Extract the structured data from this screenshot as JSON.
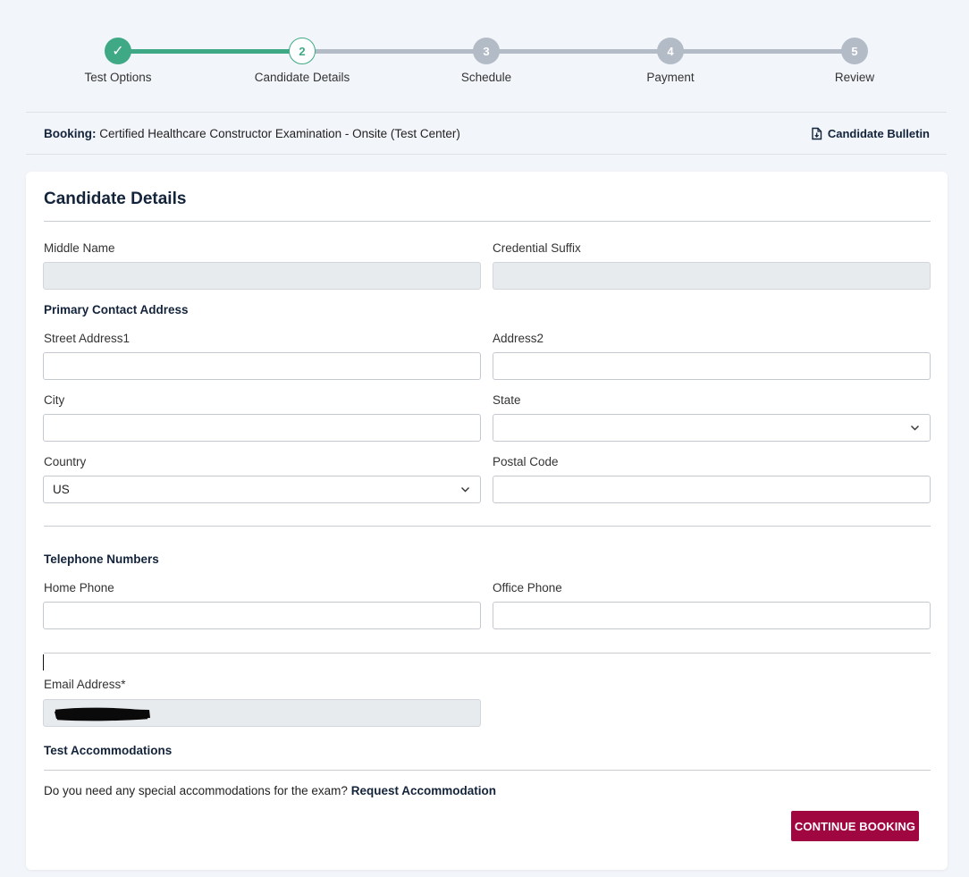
{
  "stepper": {
    "steps": [
      {
        "number": "✓",
        "label": "Test Options",
        "state": "done"
      },
      {
        "number": "2",
        "label": "Candidate Details",
        "state": "active"
      },
      {
        "number": "3",
        "label": "Schedule",
        "state": "todo"
      },
      {
        "number": "4",
        "label": "Payment",
        "state": "todo"
      },
      {
        "number": "5",
        "label": "Review",
        "state": "todo"
      }
    ]
  },
  "booking": {
    "label": "Booking:",
    "value": "Certified Healthcare Constructor Examination - Onsite (Test Center)",
    "bulletin_label": "Candidate Bulletin",
    "bulletin_icon": "document-download-icon"
  },
  "form": {
    "title": "Candidate Details",
    "middle_name": {
      "label": "Middle Name",
      "value": ""
    },
    "credential_suffix": {
      "label": "Credential Suffix",
      "value": ""
    },
    "address_section": "Primary Contact Address",
    "street1": {
      "label": "Street Address1",
      "value": ""
    },
    "address2": {
      "label": "Address2",
      "value": ""
    },
    "city": {
      "label": "City",
      "value": ""
    },
    "state": {
      "label": "State",
      "value": ""
    },
    "country": {
      "label": "Country",
      "value": "US"
    },
    "postal_code": {
      "label": "Postal Code",
      "value": ""
    },
    "phone_section": "Telephone Numbers",
    "home_phone": {
      "label": "Home Phone",
      "value": ""
    },
    "office_phone": {
      "label": "Office Phone",
      "value": ""
    },
    "email": {
      "label": "Email Address*",
      "value": ""
    },
    "accommodations_section": "Test Accommodations",
    "accommodations_question": "Do you need any special accommodations for the exam?",
    "accommodations_link": "Request Accommodation",
    "continue_label": "CONTINUE BOOKING"
  },
  "colors": {
    "accent_green": "#3ea984",
    "step_inactive": "#b3bcc6",
    "brand_navy": "#13233a",
    "continue_button": "#a0063f"
  }
}
